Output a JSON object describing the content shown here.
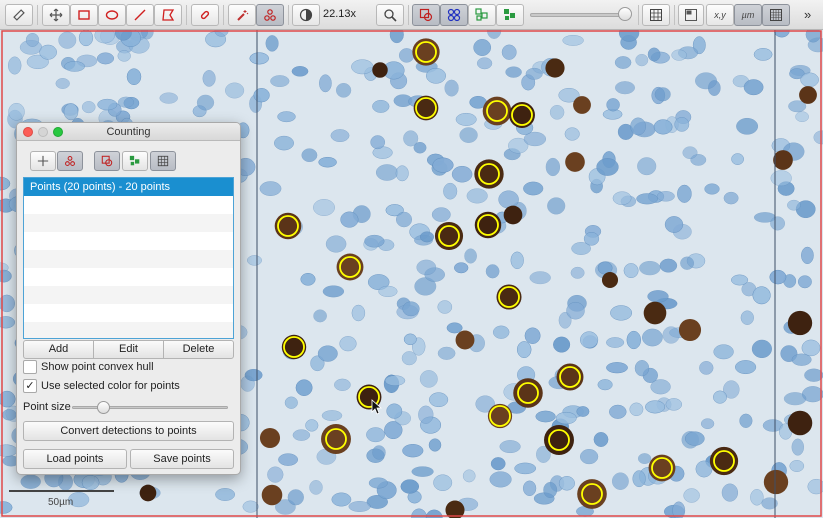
{
  "toolbar": {
    "zoom": "22.13x",
    "xy_label": "x,y",
    "um_label": "µm",
    "overflow_label": "»",
    "tools": [
      {
        "name": "measure-tool-icon"
      },
      {
        "name": "move-tool-icon"
      },
      {
        "name": "rectangle-tool-icon"
      },
      {
        "name": "ellipse-tool-icon"
      },
      {
        "name": "line-tool-icon"
      },
      {
        "name": "polygon-tool-icon"
      },
      {
        "name": "brush-tool-icon"
      },
      {
        "name": "wand-tool-icon"
      },
      {
        "name": "points-tool-icon"
      },
      {
        "name": "brightness-contrast-icon"
      },
      {
        "name": "zoom-to-fit-icon"
      },
      {
        "name": "show-annotations-icon"
      },
      {
        "name": "show-tma-grid-icon"
      },
      {
        "name": "show-detections-icon"
      },
      {
        "name": "fill-detections-icon"
      },
      {
        "name": "show-grid-icon"
      },
      {
        "name": "show-overview-icon"
      },
      {
        "name": "show-pixel-classification-icon"
      },
      {
        "name": "show-counting-grid-icon"
      }
    ]
  },
  "counting_window": {
    "title": "Counting",
    "list_items": [
      "Points (20 points) - 20 points"
    ],
    "add_label": "Add",
    "edit_label": "Edit",
    "delete_label": "Delete",
    "show_convex_hull_label": "Show point convex hull",
    "show_convex_hull_checked": false,
    "use_color_label": "Use selected color for points",
    "use_color_checked": true,
    "check_mark": "✓",
    "point_size_label": "Point size",
    "point_size_value": 0.2,
    "convert_label": "Convert detections to points",
    "load_label": "Load points",
    "save_label": "Save points"
  },
  "viewer": {
    "scale_label": "50µm",
    "point_color": "#ffff00",
    "point_count": 20,
    "border_color": "#e04848"
  },
  "colors": {
    "selection": "#1a8fd0",
    "close": "#fc5d57",
    "minimize": "#d5d5d5",
    "zoom": "#28c840"
  }
}
